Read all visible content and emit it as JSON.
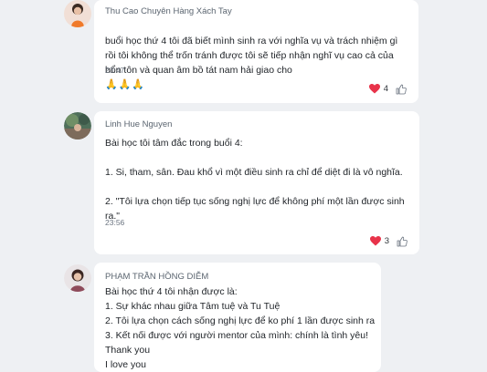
{
  "messages": [
    {
      "author": "Thu Cao Chuyên Hàng Xách Tay",
      "text": "buổi học thứ 4 tôi đã biết mình sinh ra với nghĩa vụ và trách nhiệm gì\nrồi tôi không thể trốn tránh được tôi sẽ tiếp nhận nghĩ vụ cao cả của\nbổn tôn và quan âm bồ tát nam hải giao cho",
      "emoji": "🙏🙏🙏",
      "time": "23:47",
      "reaction_count": "4"
    },
    {
      "author": "Linh Hue Nguyen",
      "text": "Bài học tôi tâm đắc trong buổi 4:\n\n1. Si, tham, sân. Đau khổ vì một điều sinh ra chỉ để diệt đi là vô nghĩa.\n\n2. \"Tôi lựa chọn tiếp tục sống nghị lực để không phí một lần được sinh\nra.\"",
      "time": "23:56",
      "reaction_count": "3"
    },
    {
      "author": "PHẠM TRẦN HỒNG DIỄM",
      "text": "Bài học thứ 4 tôi nhận được là:\n1. Sự khác nhau giữa Tâm tuệ và Tu Tuệ\n2. Tôi lựa chọn cách sống nghị lực để ko phí 1 lần được sinh ra\n3. Kết nối được với người mentor của mình: chính là tình yêu!\nThank you\nI love you"
    }
  ],
  "colors": {
    "heart": "#e8334a",
    "like": "#6b7480"
  },
  "icons": {
    "heart": "heart-icon",
    "like": "thumbs-up-icon"
  }
}
